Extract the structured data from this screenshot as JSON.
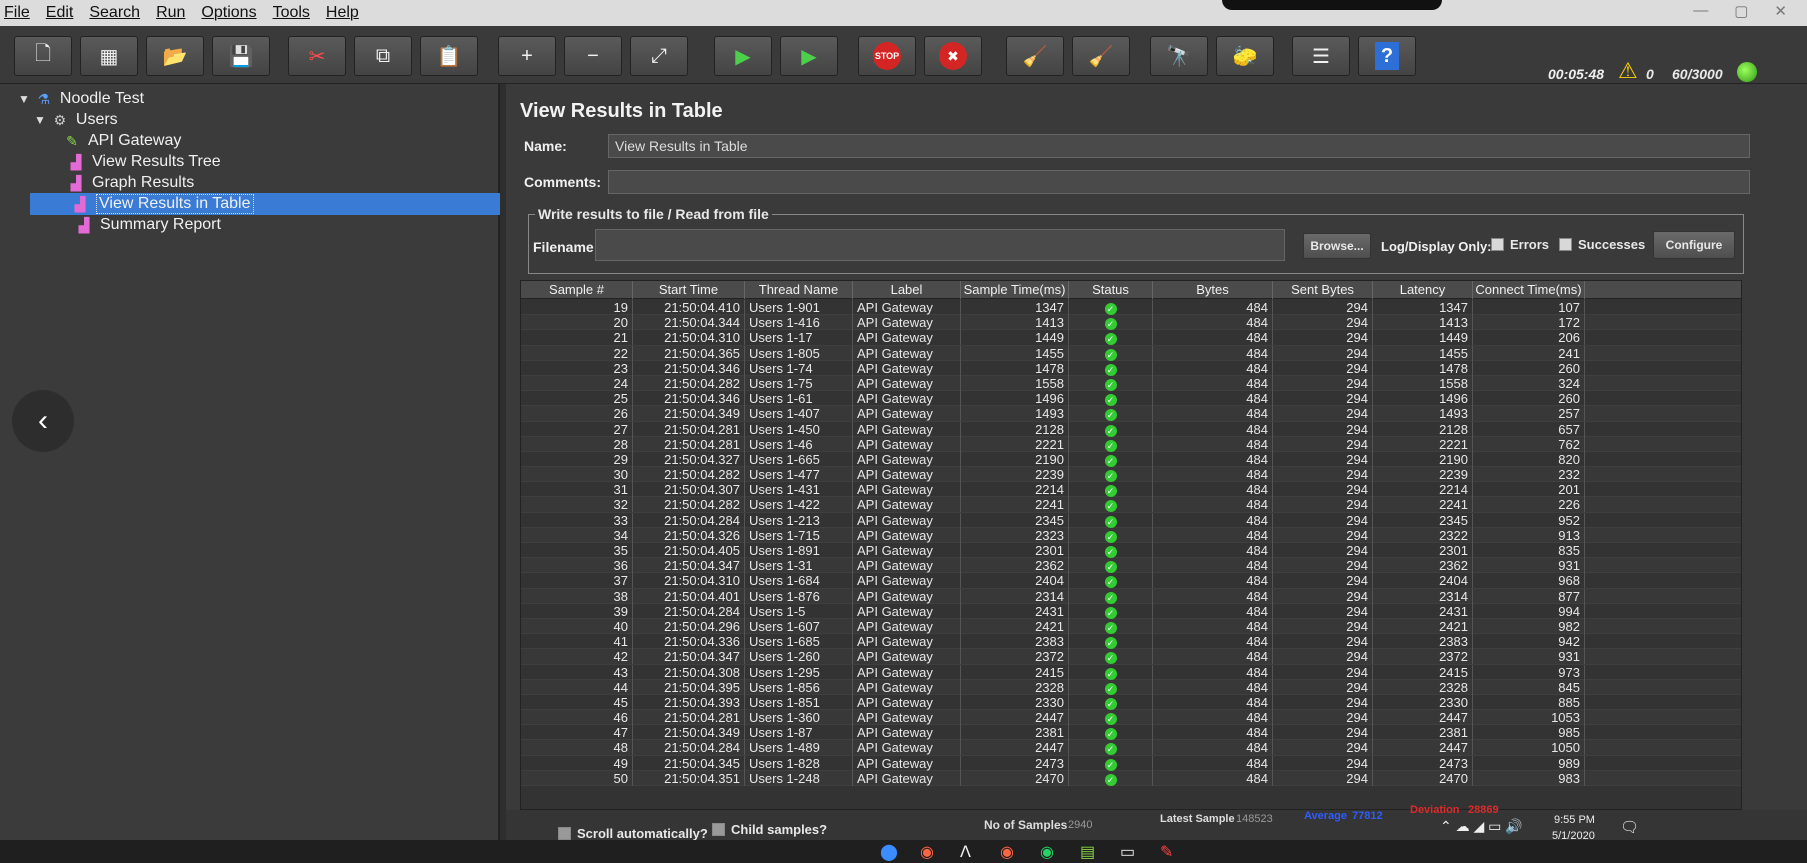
{
  "menu": [
    "File",
    "Edit",
    "Search",
    "Run",
    "Options",
    "Tools",
    "Help"
  ],
  "toolbar": {
    "buttons": [
      {
        "icon": "new-icon",
        "glyph": "🗋"
      },
      {
        "icon": "templates-icon",
        "glyph": "▦"
      },
      {
        "icon": "open-icon",
        "glyph": "📂"
      },
      {
        "icon": "save-icon",
        "glyph": "💾"
      },
      {
        "icon": "cut-icon",
        "glyph": "✂"
      },
      {
        "icon": "copy-icon",
        "glyph": "⧉"
      },
      {
        "icon": "paste-icon",
        "glyph": "📋"
      },
      {
        "icon": "expand-icon",
        "glyph": "+"
      },
      {
        "icon": "collapse-icon",
        "glyph": "−"
      },
      {
        "icon": "toggle-icon",
        "glyph": "⤢"
      },
      {
        "icon": "start-icon",
        "glyph": "▶"
      },
      {
        "icon": "start-no-pauses-icon",
        "glyph": "▶"
      },
      {
        "icon": "stop-icon",
        "glyph": "STOP"
      },
      {
        "icon": "shutdown-icon",
        "glyph": "✖"
      },
      {
        "icon": "clear-icon",
        "glyph": "🧹"
      },
      {
        "icon": "clear-all-icon",
        "glyph": "🧹"
      },
      {
        "icon": "search-icon",
        "glyph": "🔭"
      },
      {
        "icon": "reset-search-icon",
        "glyph": "🧽"
      },
      {
        "icon": "function-helper-icon",
        "glyph": "☰"
      },
      {
        "icon": "help-icon",
        "glyph": "?"
      }
    ],
    "elapsed": "00:05:48",
    "warnings": "0",
    "threads": "60/3000"
  },
  "tree": {
    "root": "Noodle Test",
    "group": "Users",
    "items": [
      "API Gateway",
      "View Results Tree",
      "Graph Results",
      "View Results in Table",
      "Summary Report"
    ]
  },
  "panel": {
    "title": "View Results in Table",
    "name_label": "Name:",
    "name_value": "View Results in Table",
    "comments_label": "Comments:",
    "comments_value": "",
    "file_group_title": "Write results to file / Read from file",
    "filename_label": "Filename",
    "filename_value": "",
    "browse": "Browse...",
    "log_display": "Log/Display Only:",
    "errors": "Errors",
    "successes": "Successes",
    "configure": "Configure"
  },
  "table": {
    "columns": [
      "Sample #",
      "Start Time",
      "Thread Name",
      "Label",
      "Sample Time(ms)",
      "Status",
      "Bytes",
      "Sent Bytes",
      "Latency",
      "Connect Time(ms)"
    ],
    "rows": [
      [
        "19",
        "21:50:04.410",
        "Users 1-901",
        "API Gateway",
        "1347",
        "484",
        "294",
        "1347",
        "107"
      ],
      [
        "20",
        "21:50:04.344",
        "Users 1-416",
        "API Gateway",
        "1413",
        "484",
        "294",
        "1413",
        "172"
      ],
      [
        "21",
        "21:50:04.310",
        "Users 1-17",
        "API Gateway",
        "1449",
        "484",
        "294",
        "1449",
        "206"
      ],
      [
        "22",
        "21:50:04.365",
        "Users 1-805",
        "API Gateway",
        "1455",
        "484",
        "294",
        "1455",
        "241"
      ],
      [
        "23",
        "21:50:04.346",
        "Users 1-74",
        "API Gateway",
        "1478",
        "484",
        "294",
        "1478",
        "260"
      ],
      [
        "24",
        "21:50:04.282",
        "Users 1-75",
        "API Gateway",
        "1558",
        "484",
        "294",
        "1558",
        "324"
      ],
      [
        "25",
        "21:50:04.346",
        "Users 1-61",
        "API Gateway",
        "1496",
        "484",
        "294",
        "1496",
        "260"
      ],
      [
        "26",
        "21:50:04.349",
        "Users 1-407",
        "API Gateway",
        "1493",
        "484",
        "294",
        "1493",
        "257"
      ],
      [
        "27",
        "21:50:04.281",
        "Users 1-450",
        "API Gateway",
        "2128",
        "484",
        "294",
        "2128",
        "657"
      ],
      [
        "28",
        "21:50:04.281",
        "Users 1-46",
        "API Gateway",
        "2221",
        "484",
        "294",
        "2221",
        "762"
      ],
      [
        "29",
        "21:50:04.327",
        "Users 1-665",
        "API Gateway",
        "2190",
        "484",
        "294",
        "2190",
        "820"
      ],
      [
        "30",
        "21:50:04.282",
        "Users 1-477",
        "API Gateway",
        "2239",
        "484",
        "294",
        "2239",
        "232"
      ],
      [
        "31",
        "21:50:04.307",
        "Users 1-431",
        "API Gateway",
        "2214",
        "484",
        "294",
        "2214",
        "201"
      ],
      [
        "32",
        "21:50:04.282",
        "Users 1-422",
        "API Gateway",
        "2241",
        "484",
        "294",
        "2241",
        "226"
      ],
      [
        "33",
        "21:50:04.284",
        "Users 1-213",
        "API Gateway",
        "2345",
        "484",
        "294",
        "2345",
        "952"
      ],
      [
        "34",
        "21:50:04.326",
        "Users 1-715",
        "API Gateway",
        "2323",
        "484",
        "294",
        "2322",
        "913"
      ],
      [
        "35",
        "21:50:04.405",
        "Users 1-891",
        "API Gateway",
        "2301",
        "484",
        "294",
        "2301",
        "835"
      ],
      [
        "36",
        "21:50:04.347",
        "Users 1-31",
        "API Gateway",
        "2362",
        "484",
        "294",
        "2362",
        "931"
      ],
      [
        "37",
        "21:50:04.310",
        "Users 1-684",
        "API Gateway",
        "2404",
        "484",
        "294",
        "2404",
        "968"
      ],
      [
        "38",
        "21:50:04.401",
        "Users 1-876",
        "API Gateway",
        "2314",
        "484",
        "294",
        "2314",
        "877"
      ],
      [
        "39",
        "21:50:04.284",
        "Users 1-5",
        "API Gateway",
        "2431",
        "484",
        "294",
        "2431",
        "994"
      ],
      [
        "40",
        "21:50:04.296",
        "Users 1-607",
        "API Gateway",
        "2421",
        "484",
        "294",
        "2421",
        "982"
      ],
      [
        "41",
        "21:50:04.336",
        "Users 1-685",
        "API Gateway",
        "2383",
        "484",
        "294",
        "2383",
        "942"
      ],
      [
        "42",
        "21:50:04.347",
        "Users 1-260",
        "API Gateway",
        "2372",
        "484",
        "294",
        "2372",
        "931"
      ],
      [
        "43",
        "21:50:04.308",
        "Users 1-295",
        "API Gateway",
        "2415",
        "484",
        "294",
        "2415",
        "973"
      ],
      [
        "44",
        "21:50:04.395",
        "Users 1-856",
        "API Gateway",
        "2328",
        "484",
        "294",
        "2328",
        "845"
      ],
      [
        "45",
        "21:50:04.393",
        "Users 1-851",
        "API Gateway",
        "2330",
        "484",
        "294",
        "2330",
        "885"
      ],
      [
        "46",
        "21:50:04.281",
        "Users 1-360",
        "API Gateway",
        "2447",
        "484",
        "294",
        "2447",
        "1053"
      ],
      [
        "47",
        "21:50:04.349",
        "Users 1-87",
        "API Gateway",
        "2381",
        "484",
        "294",
        "2381",
        "985"
      ],
      [
        "48",
        "21:50:04.284",
        "Users 1-489",
        "API Gateway",
        "2447",
        "484",
        "294",
        "2447",
        "1050"
      ],
      [
        "49",
        "21:50:04.345",
        "Users 1-828",
        "API Gateway",
        "2473",
        "484",
        "294",
        "2473",
        "989"
      ],
      [
        "50",
        "21:50:04.351",
        "Users 1-248",
        "API Gateway",
        "2470",
        "484",
        "294",
        "2470",
        "983"
      ]
    ]
  },
  "footer": {
    "scroll_auto": "Scroll automatically?",
    "child_samples": "Child samples?",
    "no_of_samples_label": "No of Samples",
    "no_of_samples": "2940",
    "latest_sample_label": "Latest Sample",
    "latest_sample": "148523",
    "average_label": "Average",
    "average": "77812",
    "deviation_label": "Deviation",
    "deviation": "28869"
  },
  "taskbar": {
    "time": "9:55 PM",
    "date": "5/1/2020"
  },
  "colors": {
    "selection": "#3a7bd5",
    "ok": "#33cc33",
    "average": "#2f5cff",
    "deviation": "#e02a2a"
  }
}
